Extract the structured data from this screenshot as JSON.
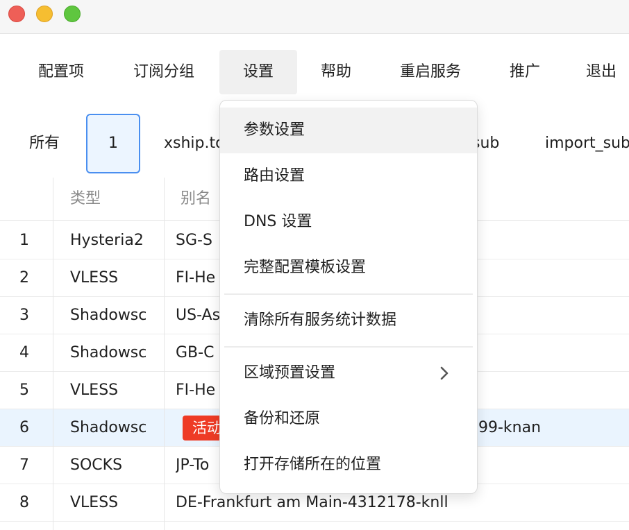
{
  "menubar": {
    "items": [
      {
        "label": "配置项"
      },
      {
        "label": "订阅分组"
      },
      {
        "label": "设置",
        "active": true
      },
      {
        "label": "帮助"
      },
      {
        "label": "重启服务"
      },
      {
        "label": "推广"
      },
      {
        "label": "退出"
      }
    ]
  },
  "groups": {
    "items": [
      {
        "label": "所有"
      },
      {
        "label": "1",
        "selected": true
      },
      {
        "label": "xship.to"
      },
      {
        "label": "sub"
      },
      {
        "label": "import_sub"
      }
    ]
  },
  "table": {
    "headers": {
      "type": "类型",
      "alias": "别名"
    },
    "rows": [
      {
        "index": "1",
        "type": "Hysteria2",
        "alias": "SG-S"
      },
      {
        "index": "2",
        "type": "VLESS",
        "alias": "FI-He"
      },
      {
        "index": "3",
        "type": "Shadowsc",
        "alias": "US-As"
      },
      {
        "index": "4",
        "type": "Shadowsc",
        "alias": "GB-C"
      },
      {
        "index": "5",
        "type": "VLESS",
        "alias": "FI-He"
      },
      {
        "index": "6",
        "type": "Shadowsc",
        "alias": "",
        "badge": "活动",
        "alias_tail": "99-knan",
        "selected": true
      },
      {
        "index": "7",
        "type": "SOCKS",
        "alias": "JP-To"
      },
      {
        "index": "8",
        "type": "VLESS",
        "alias": "DE-Frankfurt am Main-4312178-knll"
      }
    ]
  },
  "dropdown": {
    "items": [
      {
        "label": "参数设置",
        "hover": true
      },
      {
        "label": "路由设置"
      },
      {
        "label": "DNS 设置"
      },
      {
        "label": "完整配置模板设置"
      },
      {
        "label": "清除所有服务统计数据"
      },
      {
        "label": "区域预置设置",
        "submenu": true
      },
      {
        "label": "备份和还原"
      },
      {
        "label": "打开存储所在的位置"
      }
    ]
  },
  "colors": {
    "accent": "#4a8ff0",
    "selected_row": "#eaf4fe",
    "badge": "#ee3b26"
  }
}
